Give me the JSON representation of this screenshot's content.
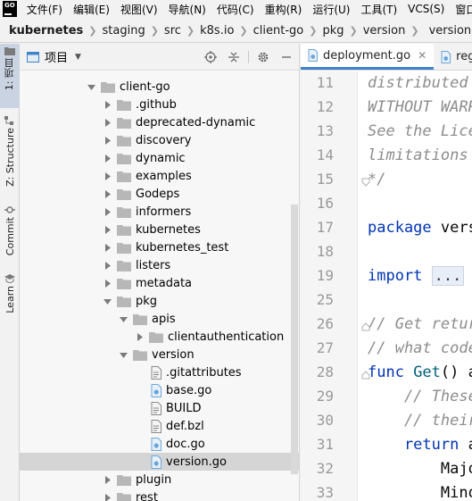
{
  "menubar": {
    "logo": "GO",
    "items": [
      "文件(F)",
      "编辑(E)",
      "视图(V)",
      "导航(N)",
      "代码(C)",
      "重构(R)",
      "运行(U)",
      "工具(T)",
      "VCS(S)",
      "窗口"
    ]
  },
  "breadcrumb": {
    "items": [
      "kubernetes",
      "staging",
      "src",
      "k8s.io",
      "client-go",
      "pkg",
      "version",
      "version.go"
    ]
  },
  "toolstrip": {
    "project": "1: 项目",
    "structure": "Z: Structure",
    "commit": "Commit",
    "learn": "Learn"
  },
  "project_panel": {
    "title": "项目",
    "tree": [
      {
        "label": "client-go",
        "type": "folder",
        "depth": 0,
        "expanded": true
      },
      {
        "label": ".github",
        "type": "folder",
        "depth": 1,
        "expanded": false
      },
      {
        "label": "deprecated-dynamic",
        "type": "folder",
        "depth": 1,
        "expanded": false
      },
      {
        "label": "discovery",
        "type": "folder",
        "depth": 1,
        "expanded": false
      },
      {
        "label": "dynamic",
        "type": "folder",
        "depth": 1,
        "expanded": false
      },
      {
        "label": "examples",
        "type": "folder",
        "depth": 1,
        "expanded": false
      },
      {
        "label": "Godeps",
        "type": "folder",
        "depth": 1,
        "expanded": false
      },
      {
        "label": "informers",
        "type": "folder",
        "depth": 1,
        "expanded": false
      },
      {
        "label": "kubernetes",
        "type": "folder",
        "depth": 1,
        "expanded": false
      },
      {
        "label": "kubernetes_test",
        "type": "folder",
        "depth": 1,
        "expanded": false
      },
      {
        "label": "listers",
        "type": "folder",
        "depth": 1,
        "expanded": false
      },
      {
        "label": "metadata",
        "type": "folder",
        "depth": 1,
        "expanded": false
      },
      {
        "label": "pkg",
        "type": "folder",
        "depth": 1,
        "expanded": true
      },
      {
        "label": "apis",
        "type": "folder",
        "depth": 2,
        "expanded": true
      },
      {
        "label": "clientauthentication",
        "type": "folder",
        "depth": 3,
        "expanded": false
      },
      {
        "label": "version",
        "type": "folder",
        "depth": 2,
        "expanded": true
      },
      {
        "label": ".gitattributes",
        "type": "file",
        "depth": 3
      },
      {
        "label": "base.go",
        "type": "gofile",
        "depth": 3
      },
      {
        "label": "BUILD",
        "type": "file",
        "depth": 3
      },
      {
        "label": "def.bzl",
        "type": "file",
        "depth": 3
      },
      {
        "label": "doc.go",
        "type": "gofile",
        "depth": 3
      },
      {
        "label": "version.go",
        "type": "gofile",
        "depth": 3,
        "selected": true
      },
      {
        "label": "plugin",
        "type": "folder",
        "depth": 1,
        "expanded": false
      },
      {
        "label": "rest",
        "type": "folder",
        "depth": 1,
        "expanded": false
      }
    ]
  },
  "editor": {
    "tabs": [
      {
        "label": "deployment.go",
        "active": true
      },
      {
        "label": "regis",
        "active": false
      }
    ],
    "lines": [
      {
        "num": "11",
        "parts": [
          {
            "c": "cmt",
            "t": "distributed under the License is distributed"
          }
        ]
      },
      {
        "num": "12",
        "parts": [
          {
            "c": "cmt",
            "t": "WITHOUT WARRANTIES OR CONDITIONS OF ANY KIND"
          }
        ]
      },
      {
        "num": "13",
        "parts": [
          {
            "c": "cmt",
            "t": "See the License for the specific language"
          }
        ]
      },
      {
        "num": "14",
        "parts": [
          {
            "c": "cmt",
            "t": "limitations under the License."
          }
        ]
      },
      {
        "num": "15",
        "parts": [
          {
            "c": "cmt",
            "t": "*/"
          }
        ]
      },
      {
        "num": "16",
        "parts": []
      },
      {
        "num": "17",
        "parts": [
          {
            "c": "kw",
            "t": "package "
          },
          {
            "c": "plain",
            "t": "version"
          }
        ]
      },
      {
        "num": "18",
        "parts": []
      },
      {
        "num": "19",
        "parts": [
          {
            "c": "kw",
            "t": "import "
          },
          {
            "c": "folded",
            "t": "..."
          }
        ]
      },
      {
        "num": "25",
        "parts": []
      },
      {
        "num": "26",
        "parts": [
          {
            "c": "cmt",
            "t": "// Get returns the overall codebase version"
          }
        ]
      },
      {
        "num": "27",
        "parts": [
          {
            "c": "cmt",
            "t": "// what code a binary was built from."
          }
        ]
      },
      {
        "num": "28",
        "parts": [
          {
            "c": "kw",
            "t": "func "
          },
          {
            "c": "fn",
            "t": "Get"
          },
          {
            "c": "plain",
            "t": "() apimachineryversion.Info {"
          }
        ]
      },
      {
        "num": "29",
        "parts": [
          {
            "c": "cmt",
            "t": "    // These variables typically come from"
          }
        ]
      },
      {
        "num": "30",
        "parts": [
          {
            "c": "cmt",
            "t": "    // their defaults are set in base.go"
          }
        ]
      },
      {
        "num": "31",
        "parts": [
          {
            "c": "kw",
            "t": "    return "
          },
          {
            "c": "plain",
            "t": "apimachineryversion.Info{"
          }
        ]
      },
      {
        "num": "32",
        "parts": [
          {
            "c": "plain",
            "t": "        Major:"
          }
        ]
      },
      {
        "num": "33",
        "parts": [
          {
            "c": "plain",
            "t": "        Minor:"
          }
        ]
      }
    ]
  },
  "colors": {
    "accent": "#4083c9",
    "folder": "#b7b7b7",
    "go_file": "#6aa6d8",
    "selected_row": "#d5d5d5"
  }
}
